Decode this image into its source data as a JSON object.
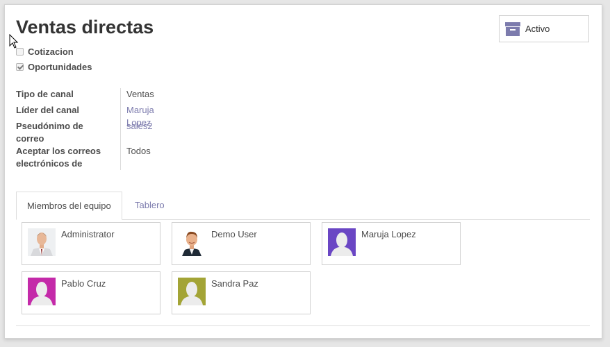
{
  "header": {
    "title": "Ventas directas"
  },
  "checkboxes": [
    {
      "label": "Cotizacion",
      "checked": false
    },
    {
      "label": "Oportunidades",
      "checked": true
    }
  ],
  "archive_button": {
    "label": "Activo",
    "icon": "archive-box-icon"
  },
  "fields": {
    "tipo_label": "Tipo de canal",
    "tipo_value": "Ventas",
    "lider_label": "Líder del canal",
    "lider_value": "Maruja Lopez",
    "alias_label_1": "Pseudónimo de",
    "alias_label_2": "correo",
    "alias_value": "sales2",
    "aceptar_label_1": "Aceptar los correos",
    "aceptar_label_2": "electrónicos de",
    "aceptar_value": "Todos"
  },
  "tabs": {
    "members": "Miembros del equipo",
    "dashboard": "Tablero"
  },
  "members": [
    {
      "name": "Administrator",
      "avatar": "photo-man-suit"
    },
    {
      "name": "Demo User",
      "avatar": "photo-man-smiling"
    },
    {
      "name": "Maruja Lopez",
      "avatar": "placeholder",
      "color": "#6a46c4"
    },
    {
      "name": "Pablo Cruz",
      "avatar": "placeholder",
      "color": "#c42aa9"
    },
    {
      "name": "Sandra Paz",
      "avatar": "placeholder",
      "color": "#a3a436"
    }
  ]
}
